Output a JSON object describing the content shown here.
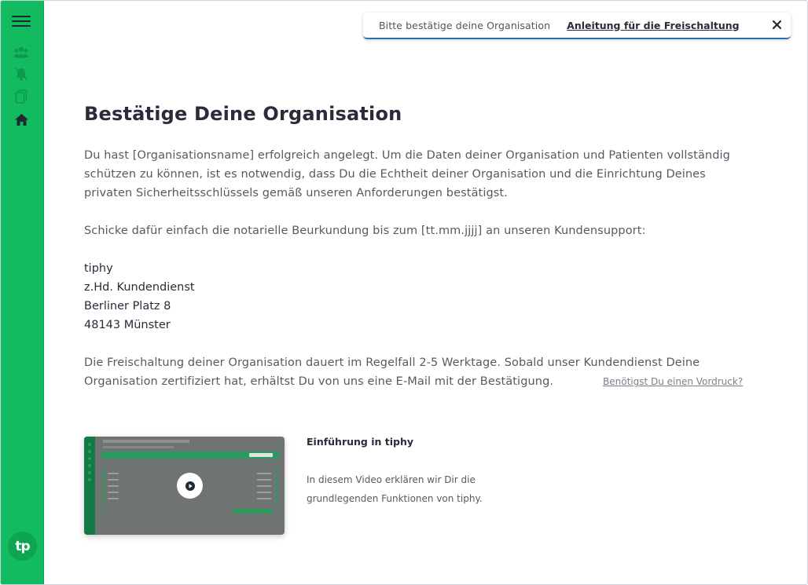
{
  "banner": {
    "info": "Bitte bestätige deine Organisation",
    "link": "Anleitung für die Freischaltung"
  },
  "sidebar": {
    "logo": "tp",
    "items": [
      "users-icon",
      "bell-icon",
      "documents-icon",
      "home-icon"
    ],
    "accent_color": "#12bb5f"
  },
  "main": {
    "title": "Bestätige Deine Organisation",
    "paragraph1": "Du hast [Organisationsname] erfolgreich angelegt. Um die Daten deiner Organisation und Patienten vollständig schützen zu können, ist es notwendig, dass Du die Echtheit deiner Organisation und die Einrichtung Deines privaten Sicherheitsschlüssels gemäß unseren Anforderungen bestätigst.",
    "paragraph2": "Schicke dafür einfach die notarielle Beurkundung bis zum [tt.mm.jjjj] an unseren Kundensupport:",
    "address": [
      "tiphy",
      "z.Hd. Kundendienst",
      "Berliner Platz 8",
      "48143 Münster"
    ],
    "paragraph3": "Die Freischaltung deiner Organisation dauert im Regelfall 2-5 Werktage. Sobald unser Kundendienst Deine Organisation zertifiziert hat, erhältst Du von uns eine E-Mail mit der Bestätigung.",
    "vordruck_link": "Benötigst Du einen Vordruck?"
  },
  "video": {
    "title": "Einführung in tiphy",
    "description": "In diesem Video erklären wir Dir die grundlegenden Funktionen von tiphy."
  }
}
